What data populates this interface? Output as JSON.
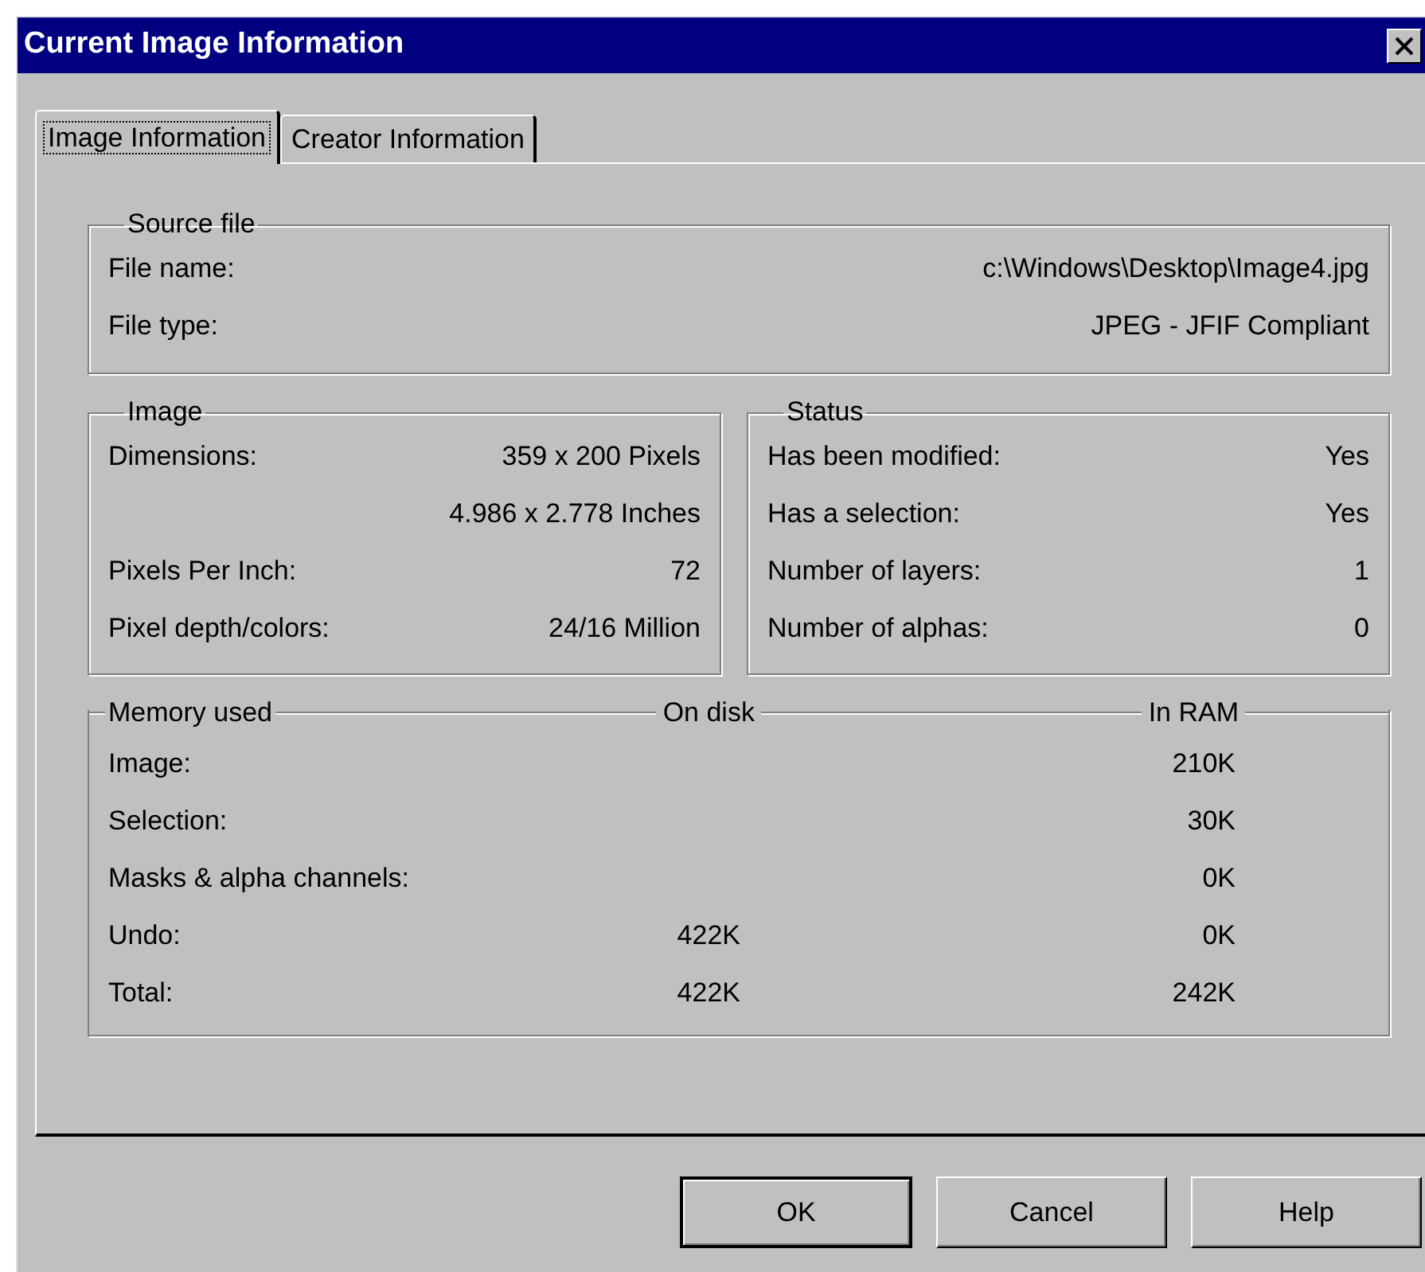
{
  "window": {
    "title": "Current Image Information"
  },
  "tabs": [
    {
      "label": "Image Information",
      "selected": true
    },
    {
      "label": "Creator Information",
      "selected": false
    }
  ],
  "source_file": {
    "title": "Source file",
    "rows": [
      {
        "label": "File name:",
        "value": "c:\\Windows\\Desktop\\Image4.jpg"
      },
      {
        "label": "File type:",
        "value": "JPEG - JFIF Compliant"
      }
    ]
  },
  "image": {
    "title": "Image",
    "rows": [
      {
        "label": "Dimensions:",
        "value": "359 x 200 Pixels"
      },
      {
        "value": "4.986 x 2.778 Inches"
      },
      {
        "label": "Pixels Per Inch:",
        "value": "72"
      },
      {
        "label": "Pixel depth/colors:",
        "value": "24/16 Million"
      }
    ]
  },
  "status": {
    "title": "Status",
    "rows": [
      {
        "label": "Has been modified:",
        "value": "Yes"
      },
      {
        "label": "Has a selection:",
        "value": "Yes"
      },
      {
        "label": "Number of layers:",
        "value": "1"
      },
      {
        "label": "Number of alphas:",
        "value": "0"
      }
    ]
  },
  "memory": {
    "title": "Memory used",
    "columns": [
      "On disk",
      "In RAM"
    ],
    "rows": [
      {
        "label": "Image:",
        "in_ram": "210K"
      },
      {
        "label": "Selection:",
        "in_ram": "30K"
      },
      {
        "label": "Masks & alpha channels:",
        "in_ram": "0K"
      },
      {
        "label": "Undo:",
        "on_disk": "422K",
        "in_ram": "0K"
      },
      {
        "label": "Total:",
        "on_disk": "422K",
        "in_ram": "242K"
      }
    ]
  },
  "buttons": [
    {
      "label": "OK",
      "default": true
    },
    {
      "label": "Cancel",
      "default": false
    },
    {
      "label": "Help",
      "default": false
    }
  ]
}
